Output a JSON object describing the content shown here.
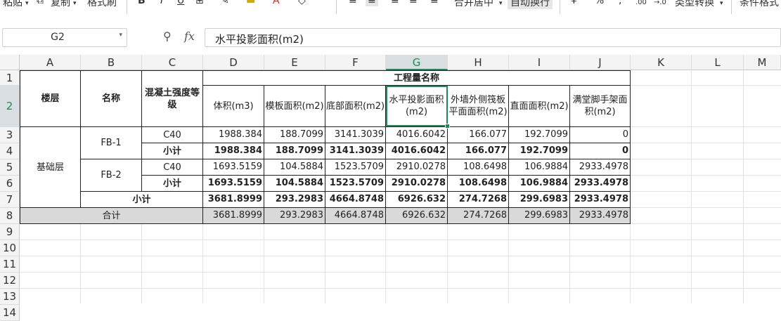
{
  "toolbar": {
    "paste": "粘贴",
    "copy": "复制",
    "format_painter": "格式刷",
    "bold": "B",
    "italic": "I",
    "underline": "U",
    "merge_center": "合并居中",
    "wrap_text": "自动换行",
    "percent": "%",
    "comma": ",",
    "decimal_inc": ".00",
    "decimal_dec": "→.0",
    "type_convert": "类型转换",
    "cond_format": "条件格式"
  },
  "name_box": "G2",
  "formula_value": "水平投影面积(m2)",
  "columns": [
    "A",
    "B",
    "C",
    "D",
    "E",
    "F",
    "G",
    "H",
    "I",
    "J",
    "K",
    "L",
    "M"
  ],
  "rows": [
    "1",
    "2",
    "3",
    "4",
    "5",
    "6",
    "7",
    "8",
    "9",
    "10",
    "11",
    "12",
    "13",
    "14"
  ],
  "table": {
    "group_header": "工程量名称",
    "floor_header": "楼层",
    "name_header": "名称",
    "grade_header": "混凝土强度等级",
    "metric_headers": [
      "体积(m3)",
      "模板面积(m2)",
      "底部面积(m2)",
      "水平投影面积(m2)",
      "外墙外侧筏板平面面积(m2)",
      "直面面积(m2)",
      "满堂脚手架面积(m2)"
    ],
    "floor": "基础层",
    "components": [
      {
        "name": "FB-1",
        "grade": "C40",
        "values": [
          "1988.384",
          "188.7099",
          "3141.3039",
          "4016.6042",
          "166.077",
          "192.7099",
          "0"
        ],
        "subtotal_label": "小计",
        "subtotal": [
          "1988.384",
          "188.7099",
          "3141.3039",
          "4016.6042",
          "166.077",
          "192.7099",
          "0"
        ]
      },
      {
        "name": "FB-2",
        "grade": "C40",
        "values": [
          "1693.5159",
          "104.5884",
          "1523.5709",
          "2910.0278",
          "108.6498",
          "106.9884",
          "2933.4978"
        ],
        "subtotal_label": "小计",
        "subtotal": [
          "1693.5159",
          "104.5884",
          "1523.5709",
          "2910.0278",
          "108.6498",
          "106.9884",
          "2933.4978"
        ]
      }
    ],
    "floor_subtotal_label": "小计",
    "floor_subtotal": [
      "3681.8999",
      "293.2983",
      "4664.8748",
      "6926.632",
      "274.7268",
      "299.6983",
      "2933.4978"
    ],
    "total_label": "合计",
    "total": [
      "3681.8999",
      "293.2983",
      "4664.8748",
      "6926.632",
      "274.7268",
      "299.6983",
      "2933.4978"
    ]
  },
  "colors": {
    "selection": "#1e8a5a",
    "total_row_bg": "#d9d9d9"
  }
}
